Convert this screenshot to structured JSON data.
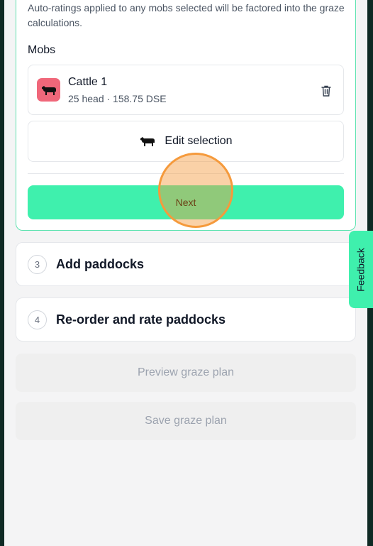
{
  "active_step": {
    "description": "Auto-ratings applied to any mobs selected will be factored into the graze calculations.",
    "mobs_heading": "Mobs",
    "mobs": [
      {
        "name": "Cattle 1",
        "meta": "25 head · 158.75 DSE",
        "icon": "cow-icon",
        "avatar_color": "#f0677a"
      }
    ],
    "edit_selection_label": "Edit selection",
    "next_label": "Next"
  },
  "steps": [
    {
      "number": "3",
      "title": "Add paddocks"
    },
    {
      "number": "4",
      "title": "Re-order and rate paddocks"
    }
  ],
  "actions": {
    "preview_label": "Preview graze plan",
    "save_label": "Save graze plan"
  },
  "feedback_label": "Feedback",
  "colors": {
    "accent": "#3ff0ad",
    "click_highlight": "#f59a3c"
  }
}
